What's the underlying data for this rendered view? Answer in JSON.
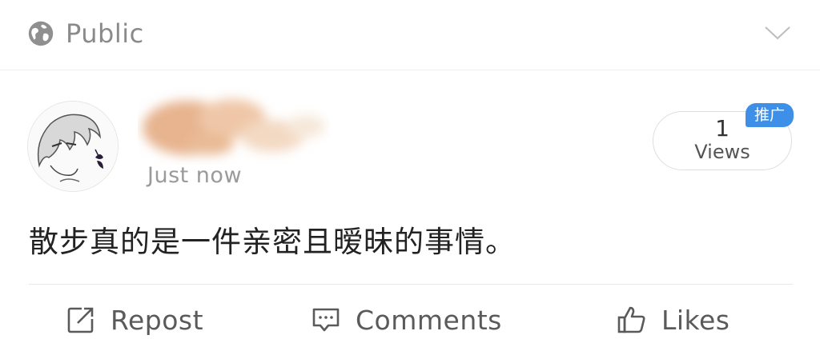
{
  "header": {
    "visibility_label": "Public",
    "visibility_icon": "globe-icon",
    "menu_icon": "chevron-down-icon"
  },
  "post": {
    "timestamp": "Just now",
    "text": "散步真的是一件亲密且暧昧的事情。",
    "views": {
      "count": "1",
      "label": "Views",
      "badge": "推广"
    }
  },
  "actions": {
    "repost_label": "Repost",
    "comments_label": "Comments",
    "likes_label": "Likes"
  },
  "colors": {
    "badge_blue": "#3d8fe8",
    "muted_text": "#8a8a8a",
    "body_text": "#222222"
  }
}
